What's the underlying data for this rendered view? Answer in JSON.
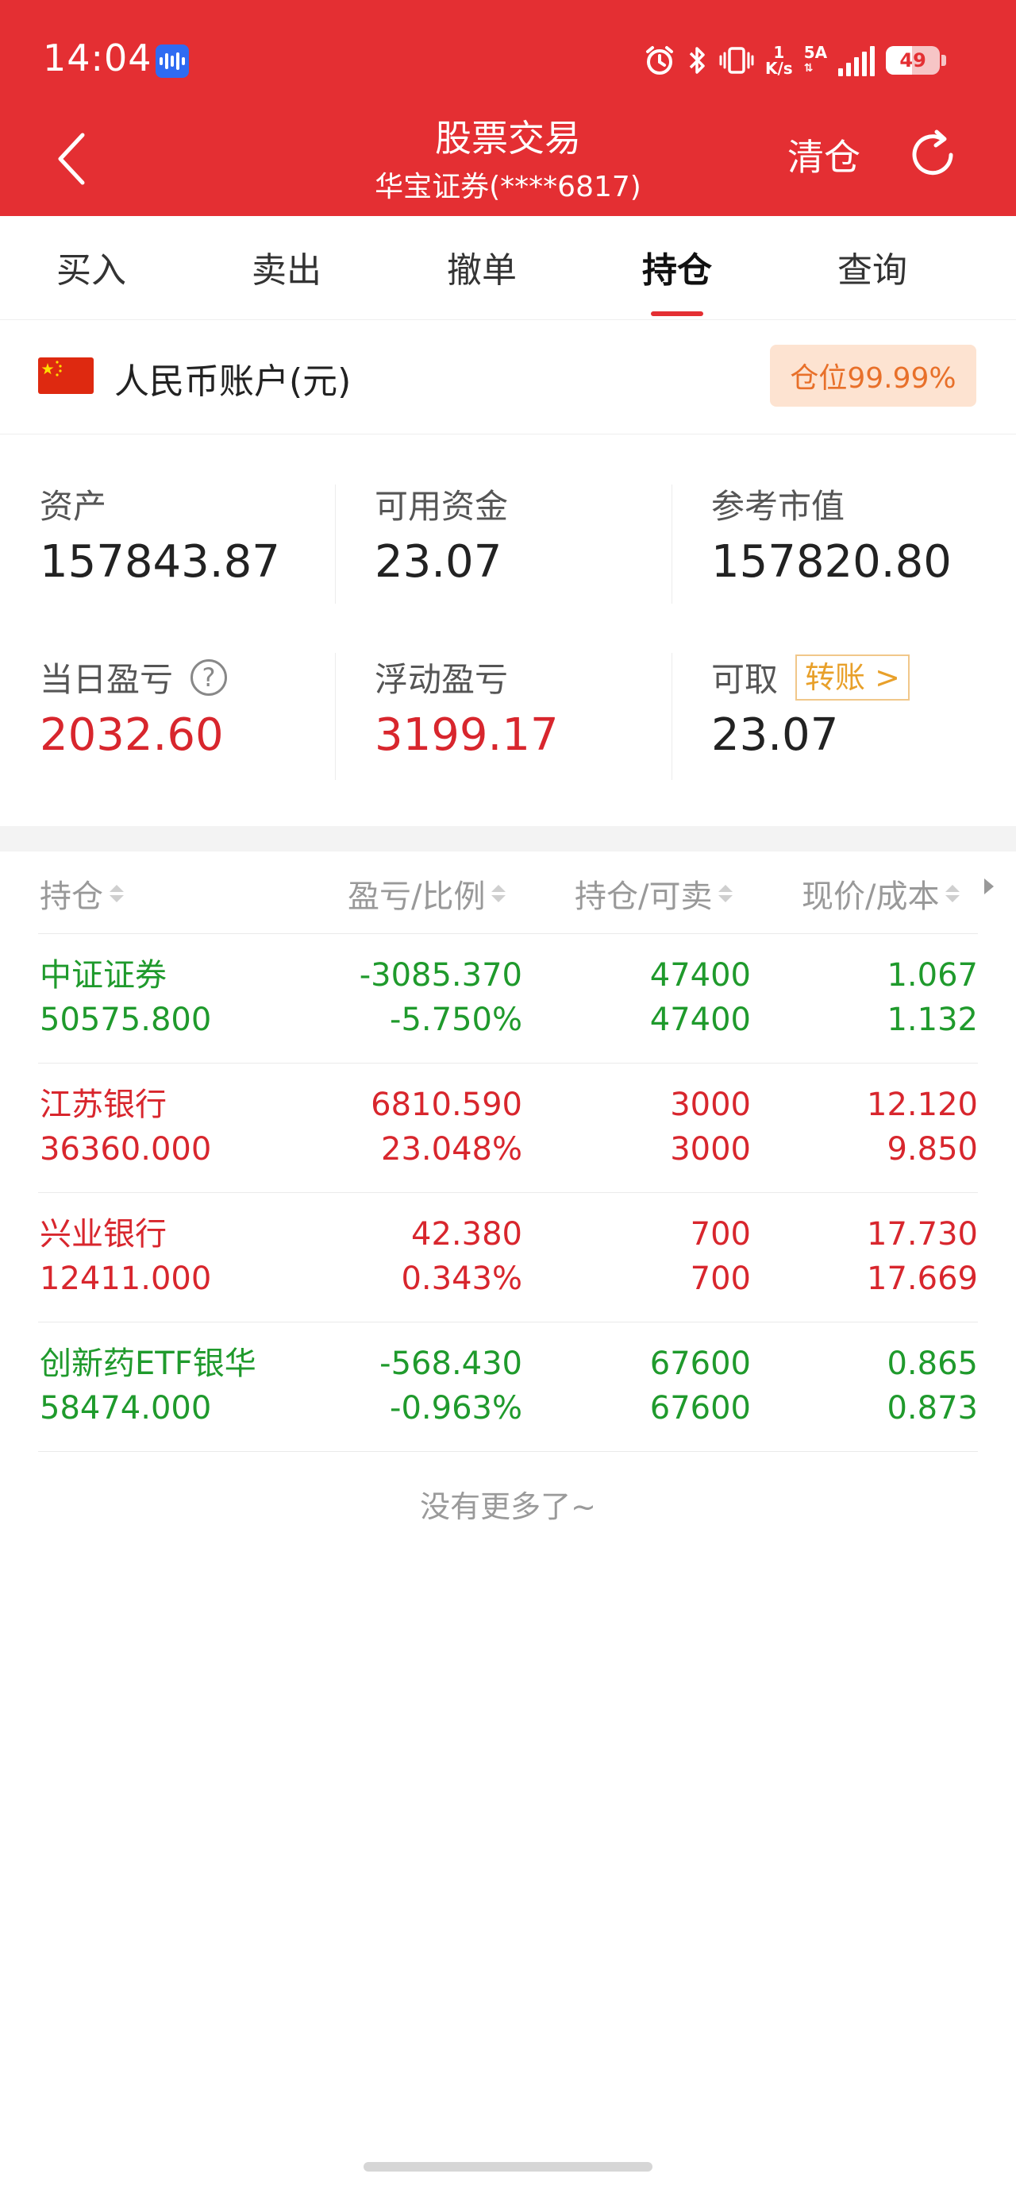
{
  "status_bar": {
    "time": "14:04",
    "net_speed_value": "1",
    "net_speed_unit": "K/s",
    "network": "5A",
    "battery": "49",
    "battery_level": 0.49
  },
  "header": {
    "title": "股票交易",
    "subtitle": "华宝证券(****6817)",
    "clear_label": "清仓"
  },
  "tabs": [
    {
      "label": "买入"
    },
    {
      "label": "卖出"
    },
    {
      "label": "撤单"
    },
    {
      "label": "持仓",
      "active": true
    },
    {
      "label": "查询"
    }
  ],
  "account": {
    "label": "人民币账户(元)",
    "position_badge": "仓位99.99%"
  },
  "summary": {
    "assets_label": "资产",
    "assets_value": "157843.87",
    "available_label": "可用资金",
    "available_value": "23.07",
    "market_label": "参考市值",
    "market_value": "157820.80",
    "daily_pl_label": "当日盈亏",
    "daily_pl_value": "2032.60",
    "floating_pl_label": "浮动盈亏",
    "floating_pl_value": "3199.17",
    "withdrawable_label": "可取",
    "transfer_label": "转账 >",
    "withdrawable_value": "23.07"
  },
  "table": {
    "headers": [
      "持仓",
      "盈亏/比例",
      "持仓/可卖",
      "现价/成本"
    ],
    "rows": [
      {
        "name": "中证证券",
        "market_value": "50575.800",
        "pl": "-3085.370",
        "pl_ratio": "-5.750%",
        "holding": "47400",
        "sellable": "47400",
        "price": "1.067",
        "cost": "1.132",
        "color": "#1f9a2c"
      },
      {
        "name": "江苏银行",
        "market_value": "36360.000",
        "pl": "6810.590",
        "pl_ratio": "23.048%",
        "holding": "3000",
        "sellable": "3000",
        "price": "12.120",
        "cost": "9.850",
        "color": "#d8262d"
      },
      {
        "name": "兴业银行",
        "market_value": "12411.000",
        "pl": "42.380",
        "pl_ratio": "0.343%",
        "holding": "700",
        "sellable": "700",
        "price": "17.730",
        "cost": "17.669",
        "color": "#d8262d"
      },
      {
        "name": "创新药ETF银华",
        "market_value": "58474.000",
        "pl": "-568.430",
        "pl_ratio": "-0.963%",
        "holding": "67600",
        "sellable": "67600",
        "price": "0.865",
        "cost": "0.873",
        "color": "#1f9a2c"
      }
    ]
  },
  "footer": {
    "no_more": "没有更多了~"
  },
  "colors": {
    "brand_red": "#e42f33",
    "gain_red": "#d8262d",
    "loss_green": "#1f9a2c",
    "badge_orange": "#e8702a"
  }
}
